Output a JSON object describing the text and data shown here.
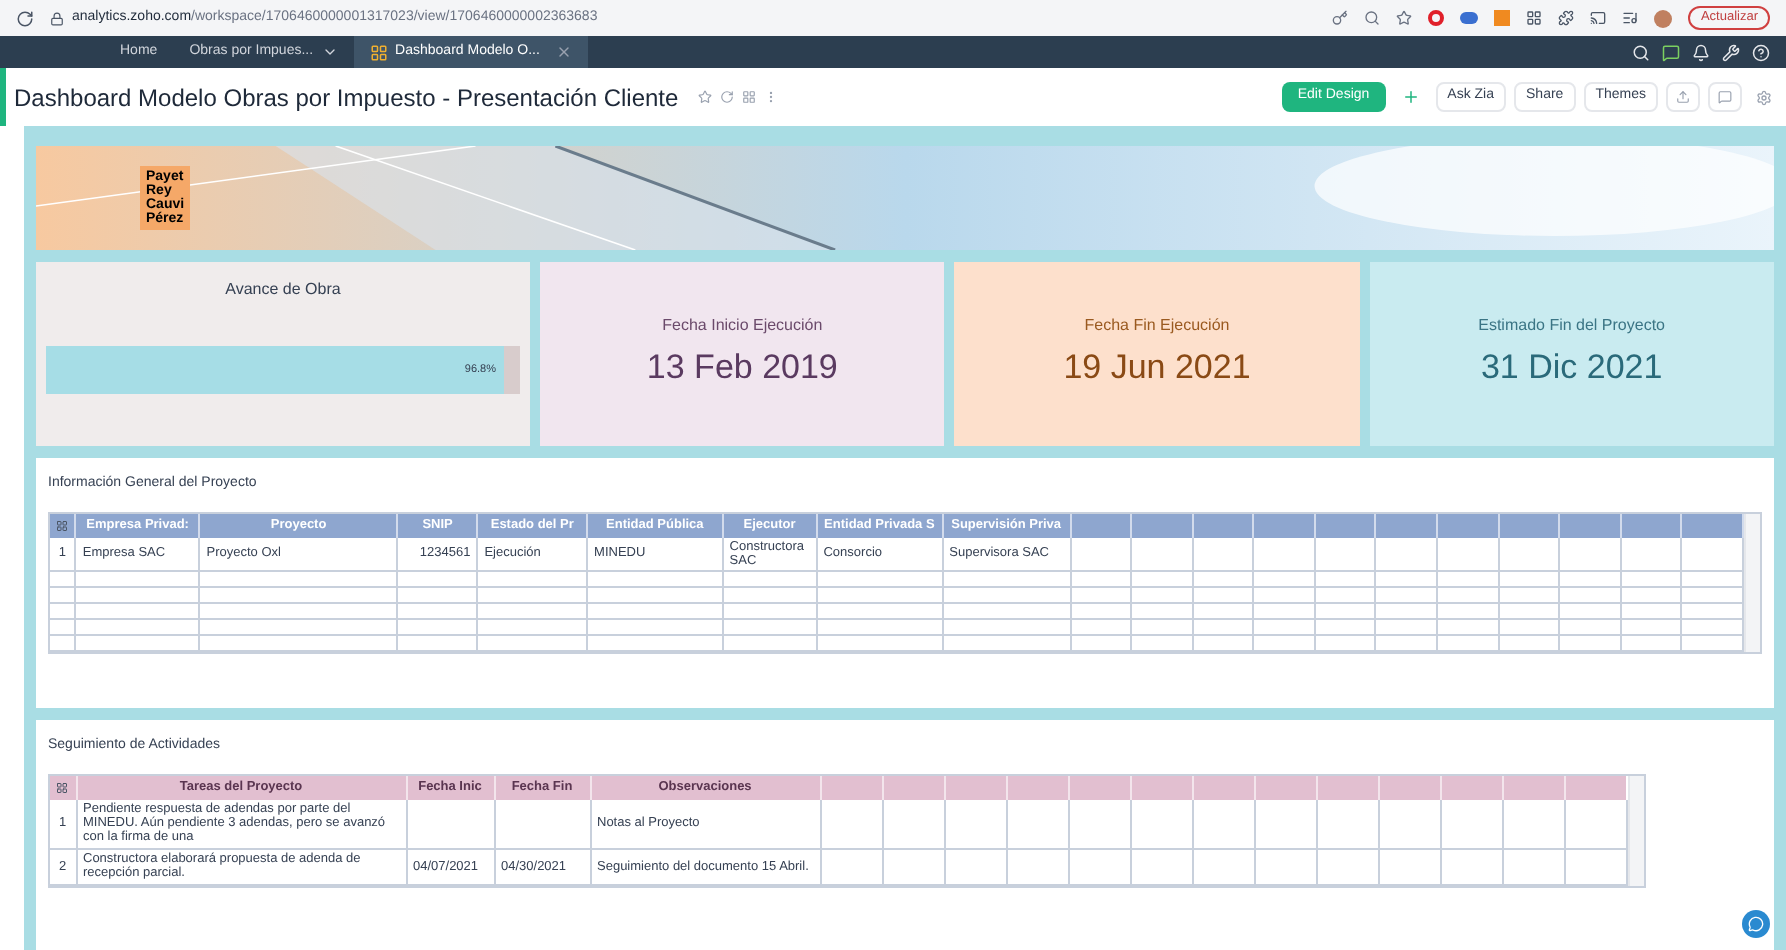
{
  "browser": {
    "url_host": "analytics.zoho.com",
    "url_path": "/workspace/1706460000001317023/view/1706460000002363683",
    "update_button": "Actualizar"
  },
  "nav": {
    "items": [
      {
        "label": "Home",
        "kind": "link",
        "selected": false
      },
      {
        "label": "Obras por Impues...",
        "kind": "dropdown",
        "selected": false
      },
      {
        "label": "Dashboard Modelo O...",
        "kind": "tab",
        "selected": true
      }
    ]
  },
  "title_bar": {
    "title": "Dashboard Modelo Obras por Impuesto - Presentación Cliente",
    "buttons": [
      {
        "label": "Edit Design",
        "kind": "primary"
      },
      {
        "kind": "plus"
      },
      {
        "label": "Ask Zia",
        "kind": "plain"
      },
      {
        "label": "Share",
        "kind": "plain"
      },
      {
        "label": "Themes",
        "kind": "plain"
      }
    ]
  },
  "banner": {
    "logo_lines": [
      "Payet",
      "Rey",
      "Cauvi",
      "Pérez"
    ]
  },
  "progress_card": {
    "title": "Avance de Obra",
    "level": 0.968,
    "reading": "96.8%"
  },
  "kpis": [
    {
      "label": "Fecha Inicio Ejecución",
      "value": "13 Feb 2019",
      "color": "#f1e6ef"
    },
    {
      "label": "Fecha Fin Ejecución",
      "value": "19 Jun 2021",
      "color": "#fde0cc"
    },
    {
      "label": "Estimado Fin del Proyecto",
      "value": "31 Dic 2021",
      "color": "#c9ebf0"
    }
  ],
  "tables": [
    {
      "title": "Información General del Proyecto",
      "columns": [
        "Empresa Privad:",
        "Proyecto",
        "SNIP",
        "Estado del Pr",
        "Entidad Pública",
        "Ejecutor",
        "Entidad Privada S",
        "Supervisión Priva"
      ],
      "rows": [
        {
          "index": "1",
          "cells": [
            "Empresa SAC",
            "Proyecto Oxl",
            "1234561",
            "Ejecución",
            "MINEDU",
            "Constructora SAC",
            "Consorcio",
            "Supervisora SAC"
          ]
        }
      ]
    },
    {
      "title": "Seguimiento de Actividades",
      "columns": [
        "Tareas del Proyecto",
        "Fecha Inic",
        "Fecha Fin",
        "Observaciones"
      ],
      "rows": [
        {
          "index": "1",
          "cells": [
            "Pendiente respuesta de adendas por parte del MINEDU. Aún pendiente 3 adendas, pero se avanzó con la firma de una",
            "",
            "",
            "Notas al Proyecto"
          ]
        },
        {
          "index": "2",
          "cells": [
            "Constructora elaborará propuesta de adenda de recepción parcial.",
            "04/07/2021",
            "04/30/2021",
            "Seguimiento del documento 15 Abril."
          ]
        }
      ]
    }
  ]
}
